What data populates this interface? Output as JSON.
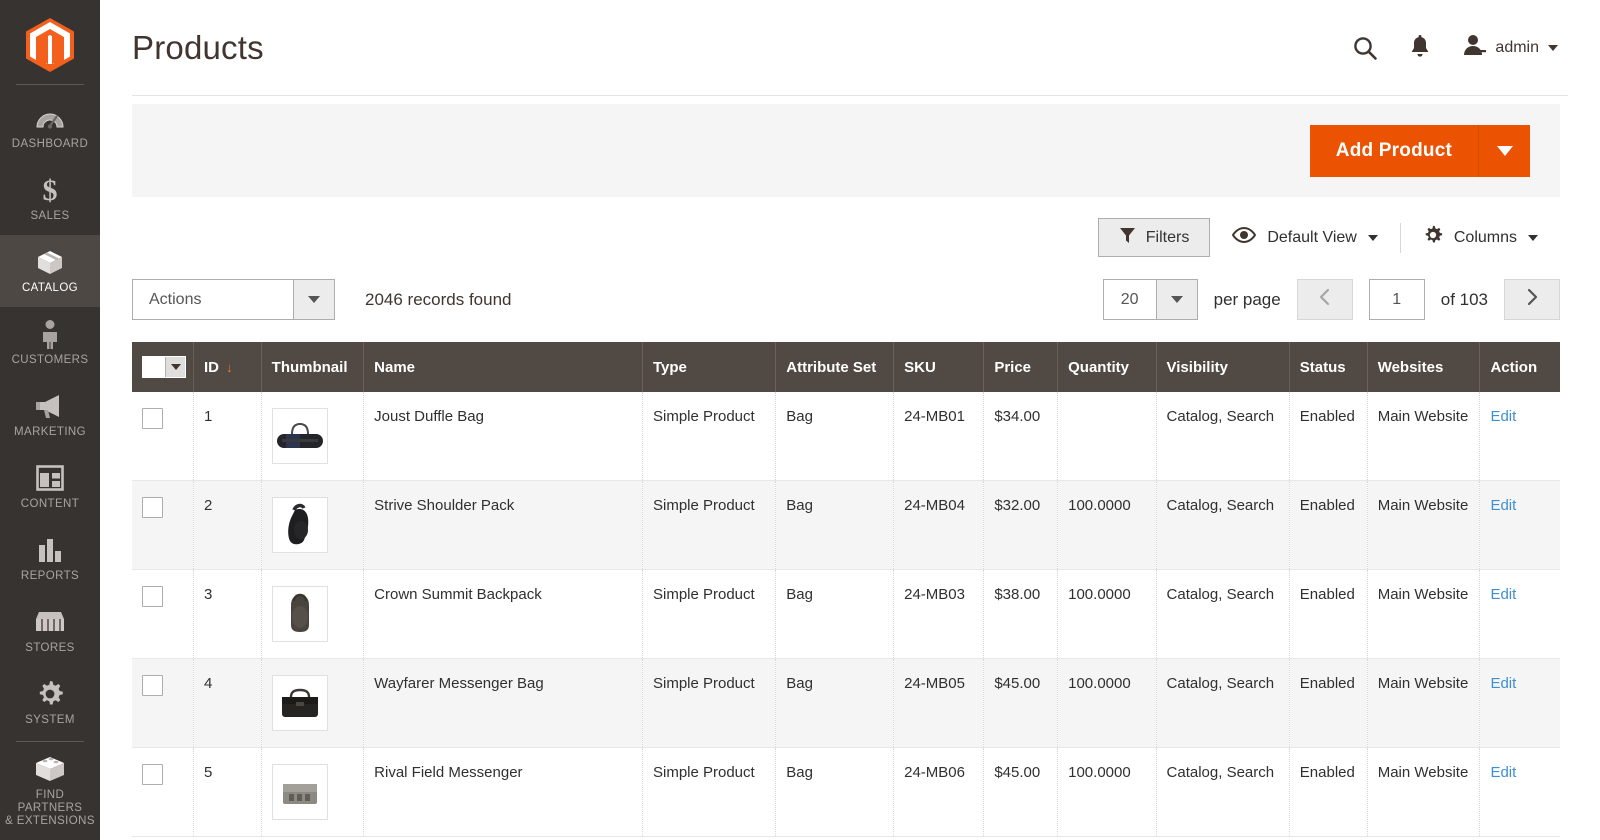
{
  "sidebar": {
    "logo_name": "magento-logo",
    "items": [
      {
        "label": "DASHBOARD",
        "icon": "dashboard-icon",
        "active": false
      },
      {
        "label": "SALES",
        "icon": "dollar-icon",
        "active": false
      },
      {
        "label": "CATALOG",
        "icon": "box-icon",
        "active": true
      },
      {
        "label": "CUSTOMERS",
        "icon": "person-icon",
        "active": false
      },
      {
        "label": "MARKETING",
        "icon": "megaphone-icon",
        "active": false
      },
      {
        "label": "CONTENT",
        "icon": "layout-icon",
        "active": false
      },
      {
        "label": "REPORTS",
        "icon": "bar-chart-icon",
        "active": false
      },
      {
        "label": "STORES",
        "icon": "storefront-icon",
        "active": false
      },
      {
        "label": "SYSTEM",
        "icon": "gear-icon",
        "active": false
      },
      {
        "label": "FIND PARTNERS\n& EXTENSIONS",
        "icon": "open-box-icon",
        "active": false
      }
    ]
  },
  "header": {
    "title": "Products",
    "search_icon": "search-icon",
    "notification_icon": "bell-icon",
    "user_icon": "user-avatar-icon",
    "user_name": "admin"
  },
  "banner": {
    "add_product_label": "Add Product",
    "add_product_arrow_icon": "caret-down-icon"
  },
  "toolbar": {
    "filters_label": "Filters",
    "filters_icon": "funnel-icon",
    "view_icon": "eye-icon",
    "view_label": "Default View",
    "columns_icon": "gear-icon",
    "columns_label": "Columns"
  },
  "controls": {
    "actions_label": "Actions",
    "records_found": "2046 records found",
    "per_page_value": "20",
    "per_page_label": "per page",
    "prev_icon": "chevron-left-icon",
    "next_icon": "chevron-right-icon",
    "current_page": "1",
    "total_pages_label": "of 103"
  },
  "table": {
    "columns": [
      {
        "key": "check",
        "label": ""
      },
      {
        "key": "id",
        "label": "ID",
        "sorted": "desc",
        "sort_glyph": "↓"
      },
      {
        "key": "thumb",
        "label": "Thumbnail"
      },
      {
        "key": "name",
        "label": "Name"
      },
      {
        "key": "type",
        "label": "Type"
      },
      {
        "key": "attr",
        "label": "Attribute Set"
      },
      {
        "key": "sku",
        "label": "SKU"
      },
      {
        "key": "price",
        "label": "Price"
      },
      {
        "key": "qty",
        "label": "Quantity"
      },
      {
        "key": "vis",
        "label": "Visibility"
      },
      {
        "key": "status",
        "label": "Status"
      },
      {
        "key": "web",
        "label": "Websites"
      },
      {
        "key": "action",
        "label": "Action"
      }
    ],
    "edit_label": "Edit",
    "rows": [
      {
        "id": "1",
        "thumb": "duffle-bag-thumbnail",
        "name": "Joust Duffle Bag",
        "type": "Simple Product",
        "attr": "Bag",
        "sku": "24-MB01",
        "price": "$34.00",
        "qty": "",
        "vis": "Catalog, Search",
        "status": "Enabled",
        "web": "Main Website"
      },
      {
        "id": "2",
        "thumb": "shoulder-pack-thumbnail",
        "name": "Strive Shoulder Pack",
        "type": "Simple Product",
        "attr": "Bag",
        "sku": "24-MB04",
        "price": "$32.00",
        "qty": "100.0000",
        "vis": "Catalog, Search",
        "status": "Enabled",
        "web": "Main Website"
      },
      {
        "id": "3",
        "thumb": "backpack-thumbnail",
        "name": "Crown Summit Backpack",
        "type": "Simple Product",
        "attr": "Bag",
        "sku": "24-MB03",
        "price": "$38.00",
        "qty": "100.0000",
        "vis": "Catalog, Search",
        "status": "Enabled",
        "web": "Main Website"
      },
      {
        "id": "4",
        "thumb": "messenger-bag-thumbnail",
        "name": "Wayfarer Messenger Bag",
        "type": "Simple Product",
        "attr": "Bag",
        "sku": "24-MB05",
        "price": "$45.00",
        "qty": "100.0000",
        "vis": "Catalog, Search",
        "status": "Enabled",
        "web": "Main Website"
      },
      {
        "id": "5",
        "thumb": "field-messenger-thumbnail",
        "name": "Rival Field Messenger",
        "type": "Simple Product",
        "attr": "Bag",
        "sku": "24-MB06",
        "price": "$45.00",
        "qty": "100.0000",
        "vis": "Catalog, Search",
        "status": "Enabled",
        "web": "Main Website"
      }
    ]
  },
  "colors": {
    "accent_orange": "#eb5202",
    "sidebar_bg": "#373330",
    "table_header_bg": "#514943",
    "link_blue": "#3d8fd1",
    "sort_arrow": "#ee7d2d"
  }
}
